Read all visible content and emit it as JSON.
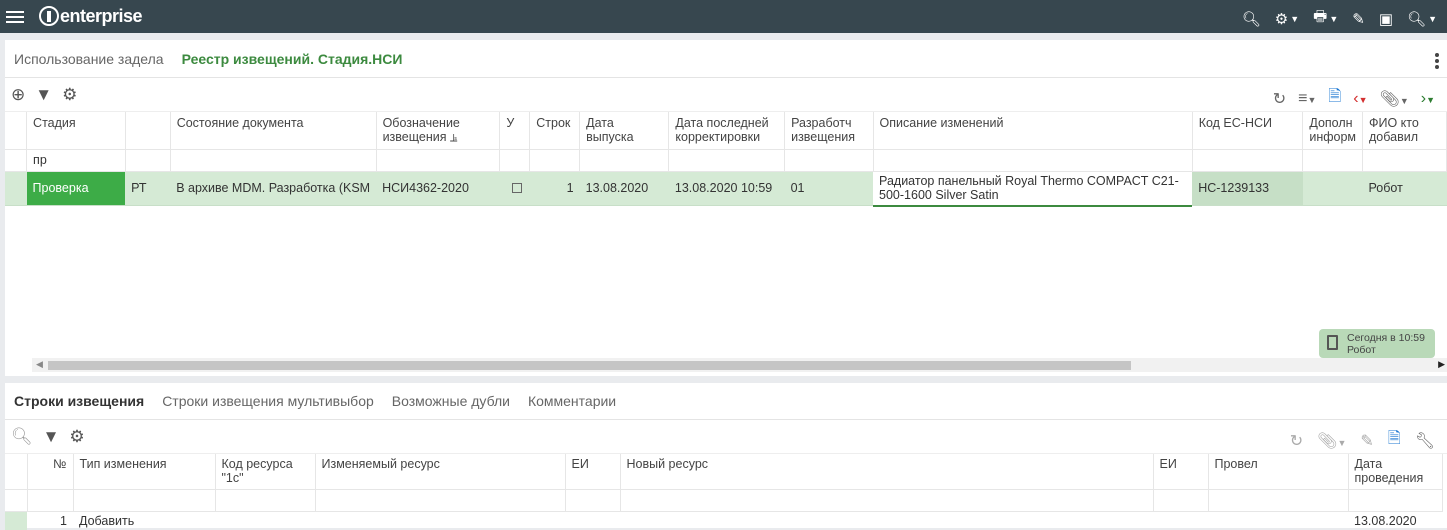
{
  "app": {
    "logo_text": "enterprise"
  },
  "topbar": {
    "icons": [
      "menu-icon",
      "search-icon",
      "gear-icon",
      "print-icon",
      "edit-icon",
      "archive-icon",
      "search-menu-icon"
    ]
  },
  "tabs_top": [
    "Использование задела",
    "Реестр извещений. Стадия.НСИ"
  ],
  "grid1": {
    "columns": [
      "Стадия",
      "",
      "Состояние документа",
      "Обозначение извещения",
      "У",
      "Строк",
      "Дата выпуска",
      "Дата последней корректировки",
      "Разработч извещения",
      "Описание изменений",
      "Код ЕС-НСИ",
      "Дополн информ",
      "ФИО кто добавил"
    ],
    "filter": {
      "stage": "пр"
    },
    "rows": [
      {
        "stage": "Проверка",
        "type": "РТ",
        "state": "В архиве MDM. Разработка (KSM",
        "notice": "НСИ4362-2020",
        "lines": "1",
        "issue_date": "13.08.2020",
        "last_edit": "13.08.2020 10:59",
        "developer": "01",
        "description": "Радиатор панельный Royal Thermo COMPACT C21-500-1600 Silver Satin",
        "code": "НС-1239133",
        "extra": "",
        "added_by": "Робот"
      }
    ]
  },
  "stamp": {
    "line1": "Сегодня в 10:59",
    "line2": "Робот"
  },
  "tabs_bottom": [
    "Строки извещения",
    "Строки извещения мультивыбор",
    "Возможные дубли",
    "Комментарии"
  ],
  "grid2": {
    "columns": [
      "№",
      "Тип изменения",
      "Код ресурса \"1с\"",
      "Изменяемый ресурс",
      "ЕИ",
      "Новый ресурс",
      "ЕИ",
      "Провел",
      "Дата проведения"
    ],
    "rows": [
      {
        "n": "1",
        "type": "Добавить",
        "code": "",
        "resource": "",
        "unit": "",
        "new_resource": "",
        "unit2": "",
        "by": "",
        "date": "13.08.2020"
      }
    ]
  }
}
